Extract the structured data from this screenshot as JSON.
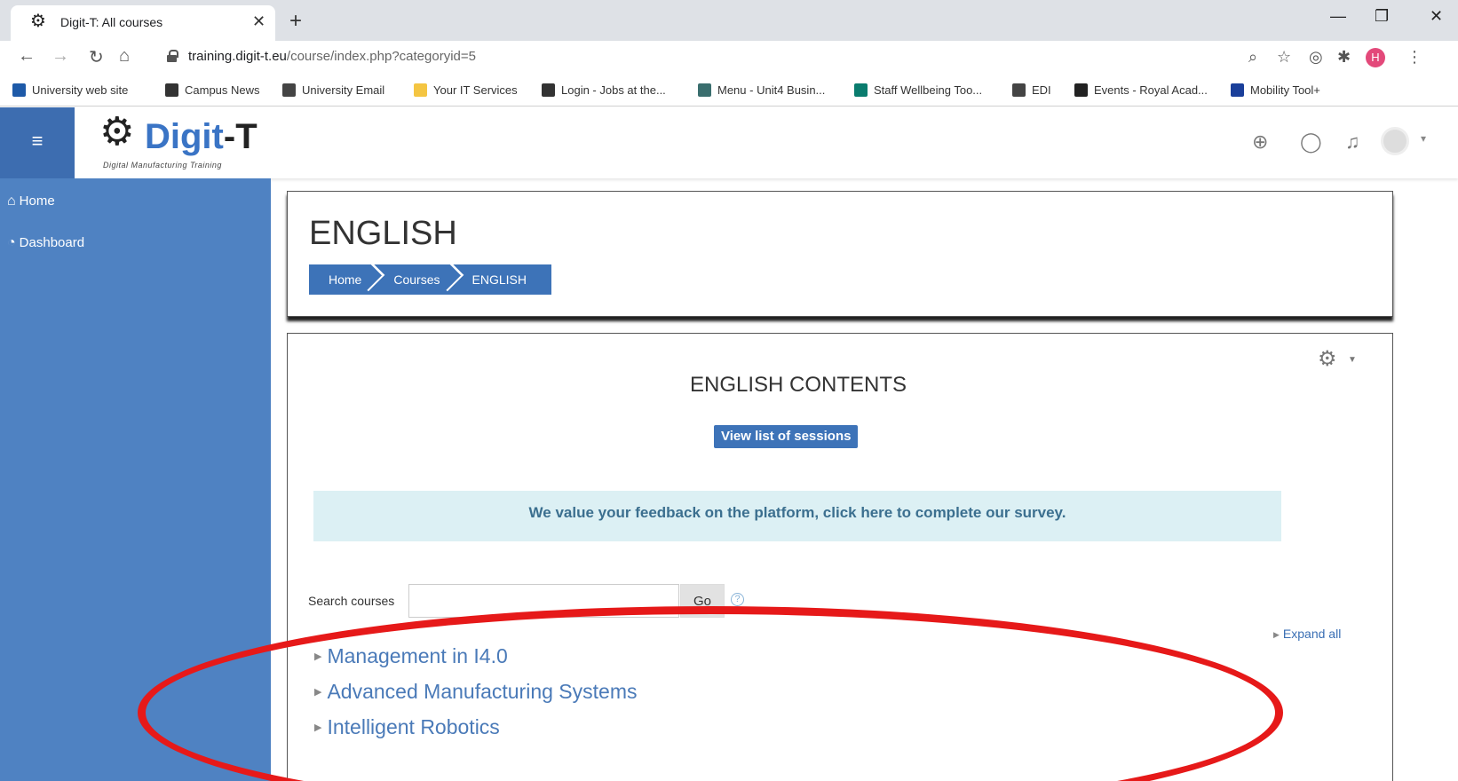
{
  "browser": {
    "tab": {
      "favicon": "gear-icon",
      "title": "Digit-T: All courses"
    },
    "url_domain": "training.digit-t.eu",
    "url_path": "/course/index.php?categoryid=5",
    "profile_initial": "H",
    "bookmarks": [
      {
        "label": "University web site",
        "icon_color": "#1e5aa8"
      },
      {
        "label": "Campus News",
        "icon_color": "#333333"
      },
      {
        "label": "University Email",
        "icon_color": "#444444"
      },
      {
        "label": "Your IT Services",
        "icon_color": "#f4c542"
      },
      {
        "label": "Login - Jobs at the...",
        "icon_color": "#333333"
      },
      {
        "label": "Menu - Unit4 Busin...",
        "icon_color": "#3a6e6e"
      },
      {
        "label": "Staff Wellbeing Too...",
        "icon_color": "#0a7c6e"
      },
      {
        "label": "EDI",
        "icon_color": "#444444"
      },
      {
        "label": "Events - Royal Acad...",
        "icon_color": "#222222"
      },
      {
        "label": "Mobility Tool+",
        "icon_color": "#1a3f9a"
      }
    ]
  },
  "site": {
    "logo_text_a": "Digit",
    "logo_text_b": "-T",
    "logo_subtitle": "Digital Manufacturing Training"
  },
  "sidebar": {
    "items": [
      {
        "label": "Home",
        "icon": "home-icon"
      },
      {
        "label": "Dashboard",
        "icon": "dashboard-icon"
      }
    ]
  },
  "main": {
    "title": "ENGLISH",
    "breadcrumb": [
      "Home",
      "Courses",
      "ENGLISH"
    ],
    "section_title": "ENGLISH CONTENTS",
    "sessions_button": "View list of sessions",
    "feedback": "We value your feedback on the platform, click here to complete our survey.",
    "search_label": "Search courses",
    "search_value": "",
    "go_button": "Go",
    "help": "?",
    "expand_all": "Expand all",
    "categories": [
      "Management in I4.0",
      "Advanced Manufacturing Systems",
      "Intelligent Robotics"
    ]
  },
  "colors": {
    "brand_blue": "#3d73b8",
    "sidebar": "#4f82c2",
    "annotation_red": "#e61919"
  }
}
